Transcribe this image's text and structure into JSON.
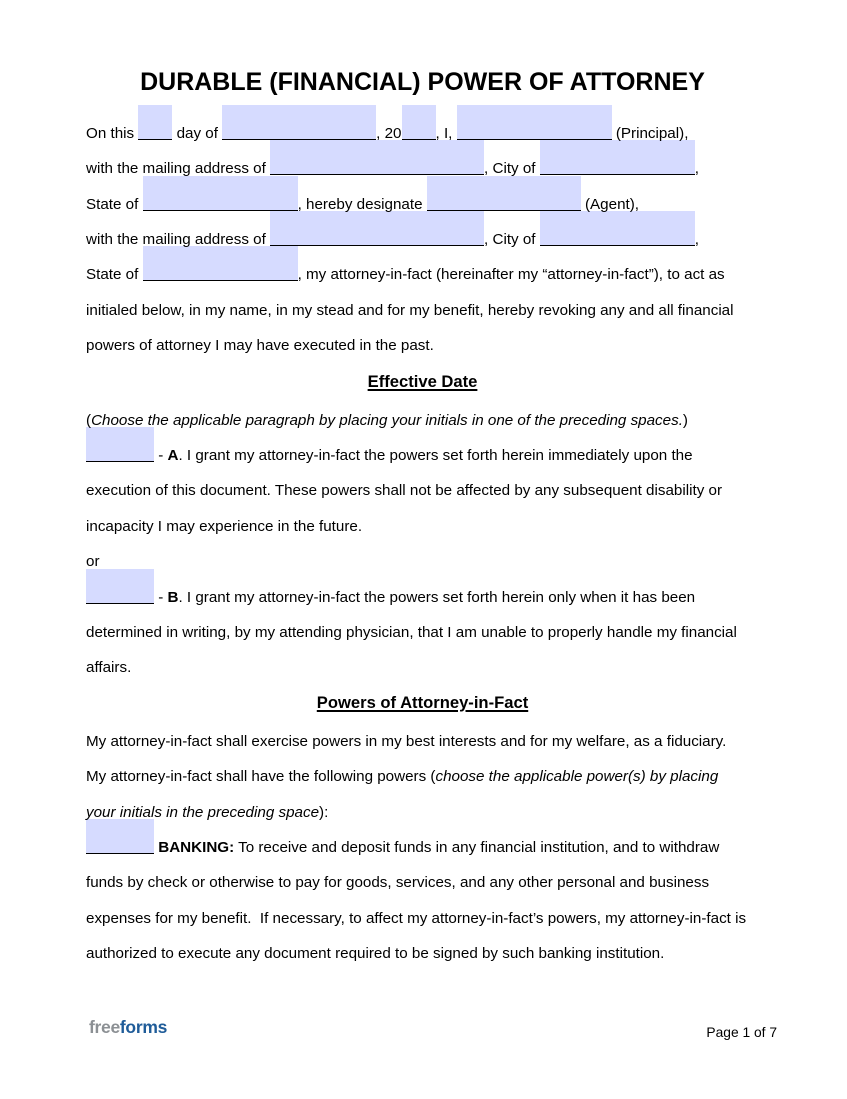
{
  "theme": {
    "field_fill": "#D6DBFF",
    "logo_free": "#8C9094",
    "logo_forms": "#1F5C99"
  },
  "document": {
    "title": "DURABLE (FINANCIAL) POWER OF ATTORNEY"
  },
  "intro": {
    "row1": {
      "t1": "On this ",
      "t2": " day of ",
      "t3": ", 20",
      "t4": ", I, ",
      "t5": " (Principal),"
    },
    "row2": {
      "t1": "with the mailing address of ",
      "t2": ", City of ",
      "t3": ","
    },
    "row3": {
      "t1": "State of ",
      "t2": ", hereby designate ",
      "t3": " (Agent),"
    },
    "row4": {
      "t1": "with the mailing address of ",
      "t2": ", City of ",
      "t3": ","
    },
    "row5": {
      "t1": "State of ",
      "t2": ", my attorney-in-fact (hereinafter my “attorney-in-fact”), to act as"
    },
    "row6": "initialed below, in my name, in my stead and for my benefit, hereby revoking any and all financial",
    "row7": "powers of attorney I may have executed in the past."
  },
  "fields": {
    "day": "",
    "month": "",
    "year": "",
    "principal_name": "",
    "principal_address": "",
    "principal_city": "",
    "principal_state": "",
    "agent_name": "",
    "agent_address": "",
    "agent_city": "",
    "agent_state": "",
    "initials_option_a": "",
    "initials_option_b": "",
    "initials_banking": ""
  },
  "effective_date": {
    "heading": "Effective Date",
    "instruction_open": "(",
    "instruction_italic": "Choose the applicable paragraph by placing your initials in one of the preceding spaces.",
    "instruction_close": ")",
    "option_a": {
      "dash": " - ",
      "letter": "A",
      "text": ". I grant my attorney-in-fact the powers set forth herein immediately upon the",
      "lines": [
        "execution of this document. These powers shall not be affected by any subsequent disability or",
        "incapacity I may experience in the future."
      ]
    },
    "or": "or",
    "option_b": {
      "dash": " - ",
      "letter": "B",
      "text": ". I grant my attorney-in-fact the powers set forth herein only when it has been",
      "lines": [
        "determined in writing, by my attending physician, that I am unable to properly handle my financial",
        "affairs."
      ]
    }
  },
  "powers": {
    "heading": "Powers of Attorney-in-Fact",
    "line1": "My attorney-in-fact shall exercise powers in my best interests and for my welfare, as a fiduciary.",
    "line2_normal": "My attorney-in-fact shall have the following powers (",
    "line2_italic": "choose the applicable power(s) by placing",
    "line3_italic": "your initials in the preceding space",
    "line3_normal": "):",
    "banking": {
      "label": "BANKING:",
      "text": " To receive and deposit funds in any financial institution, and to withdraw",
      "lines": [
        "funds by check or otherwise to pay for goods, services, and any other personal and business",
        "expenses for my benefit.  If necessary, to affect my attorney-in-fact’s powers, my attorney-in-fact is",
        "authorized to execute any document required to be signed by such banking institution."
      ]
    }
  },
  "footer": {
    "logo_part1": "free",
    "logo_part2": "forms",
    "page_label": "Page 1 of 7"
  }
}
